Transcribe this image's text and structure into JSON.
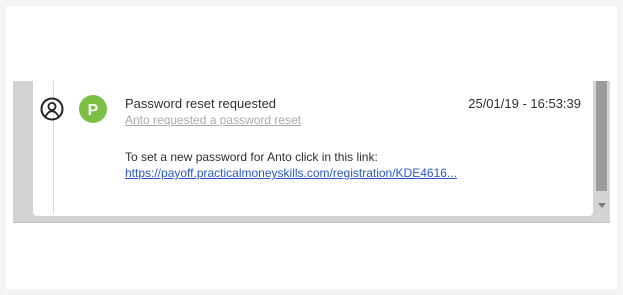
{
  "colors": {
    "avatar": "#7cc043",
    "link": "#2a57c8",
    "text": "#303030",
    "muted": "#aaaaaa",
    "scrollbar_thumb": "#9b9b9b"
  },
  "event": {
    "avatar_letter": "P",
    "title": "Password reset requested",
    "subtitle": "Anto requested a password reset",
    "timestamp": "25/01/19 - 16:53:39",
    "message": "To set a new password for Anto click in this link:",
    "link": "https://payoff.practicalmoneyskills.com/registration/KDE4616..."
  },
  "icons": {
    "user": "user-circle-icon",
    "scroll_down": "chevron-down-icon"
  }
}
